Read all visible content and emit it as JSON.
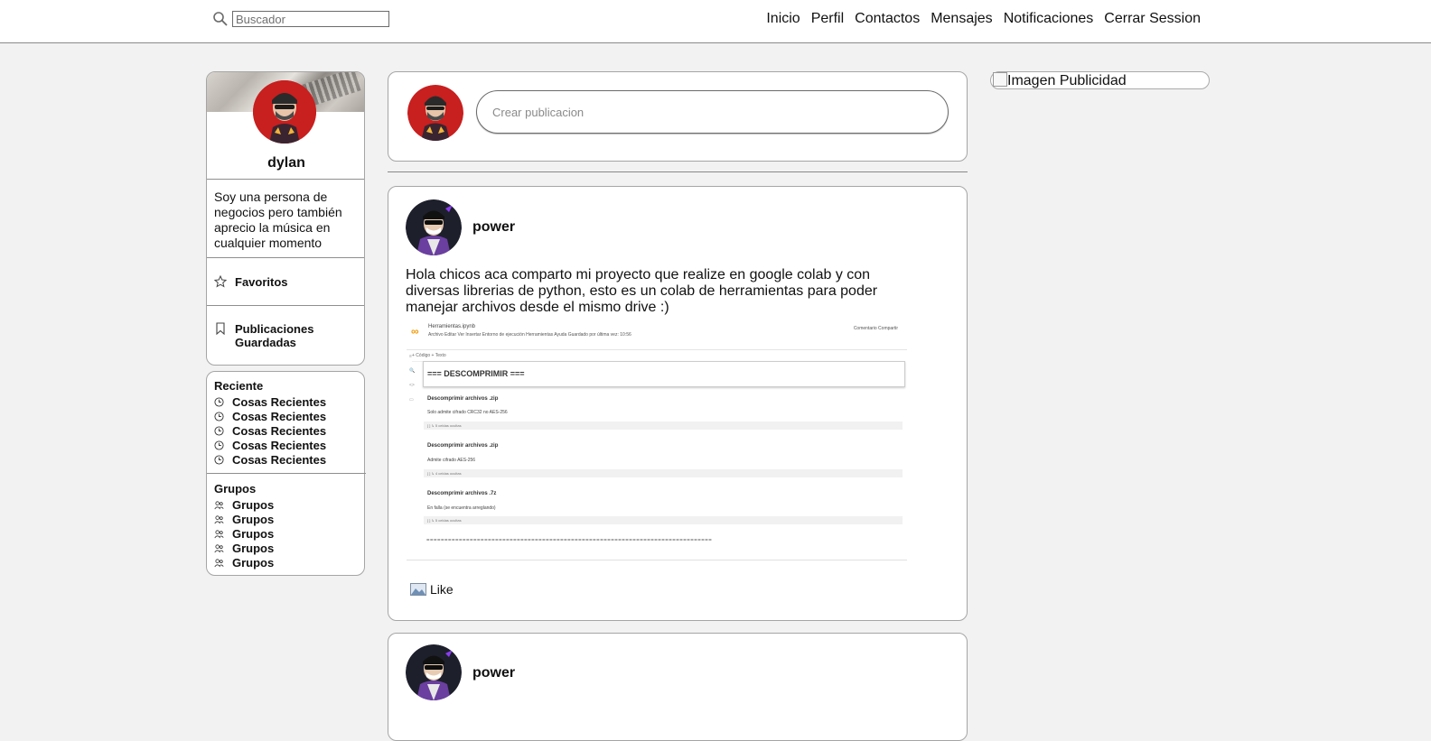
{
  "search": {
    "placeholder": "Buscador"
  },
  "nav": {
    "items": [
      "Inicio",
      "Perfil",
      "Contactos",
      "Mensajes",
      "Notificaciones",
      "Cerrar Session"
    ]
  },
  "profile": {
    "name": "dylan",
    "bio": "Soy una persona de negocios pero también aprecio la música en cualquier momento",
    "links": [
      {
        "label": "Favoritos",
        "icon": "star-icon"
      },
      {
        "label": "Publicaciones Guardadas",
        "icon": "bookmark-icon"
      }
    ]
  },
  "recent": {
    "title": "Reciente",
    "items": [
      "Cosas Recientes",
      "Cosas Recientes",
      "Cosas Recientes",
      "Cosas Recientes",
      "Cosas Recientes"
    ]
  },
  "groups": {
    "title": "Grupos",
    "items": [
      "Grupos",
      "Grupos",
      "Grupos",
      "Grupos",
      "Grupos"
    ]
  },
  "composer": {
    "placeholder": "Crear publicacion"
  },
  "posts": [
    {
      "author": "power",
      "text": "Hola chicos aca comparto mi proyecto que realize en google colab y con diversas librerias de python, esto es un colab de herramientas para poder manejar archivos desde el mismo drive :)",
      "like_label": "Like",
      "screenshot": {
        "file": "Herramientas.ipynb",
        "menu": "Archivo  Editar  Ver  Insertar  Entorno de ejecución  Herramientas  Ayuda  Guardado por última vez: 10:56",
        "right": "Comentario   Compartir",
        "toolbar": "+ Código   + Texto",
        "heading": "=== DESCOMPRIMIR ===",
        "sections": [
          {
            "title": "Descomprimir archivos .zip",
            "note": "Solo admite cifrado CRC32 no AES-256",
            "code": "[ ]  ↳ 5 celdas ocultas"
          },
          {
            "title": "Descomprimir archivos .zip",
            "note": "Admite cifrado AES-256",
            "code": "[ ]  ↳ 4 celdas ocultas"
          },
          {
            "title": "Descomprimir archivos .7z",
            "note": "En falla (se encuentra arreglando)",
            "code": "[ ]  ↳ 5 celdas ocultas"
          }
        ],
        "dashes": "==============================================================================="
      }
    },
    {
      "author": "power"
    }
  ],
  "ad": {
    "alt": "Imagen Publicidad"
  },
  "colors": {
    "background": "#f2f2f2",
    "card": "#ffffff",
    "border": "#a5a5a5",
    "avatar_red": "#c81f1f"
  }
}
